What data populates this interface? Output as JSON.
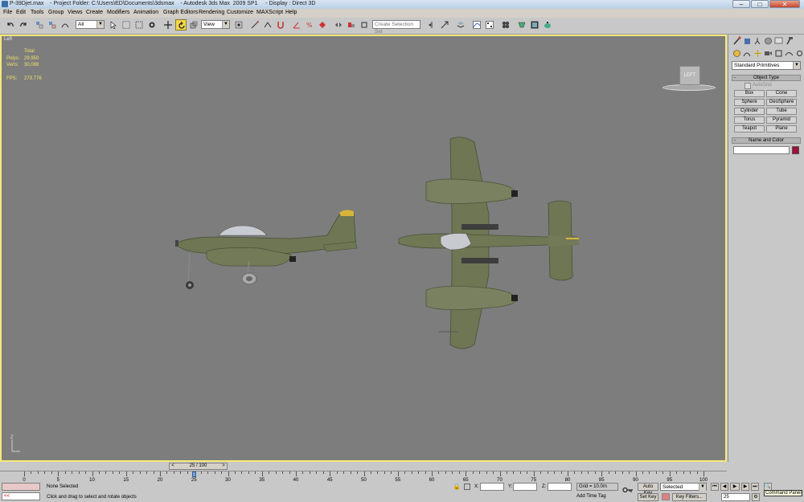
{
  "window": {
    "title": "P-39Djet.max    - Project Folder: C:\\Users\\ED\\Documents\\3dsmax    - Autodesk 3ds Max  2009 SP1     - Display : Direct 3D",
    "minimize": "–",
    "maximize": "□",
    "close": "✕"
  },
  "menu": [
    "File",
    "Edit",
    "Tools",
    "Group",
    "Views",
    "Create",
    "Modifiers",
    "Animation",
    "Graph Editors",
    "Rendering",
    "Customize",
    "MAXScript",
    "Help"
  ],
  "toolbar": {
    "selection_filter": "All",
    "reference_coord": "View",
    "named_selection_placeholder": "Create Selection Set"
  },
  "viewport": {
    "label": "Left",
    "stats_header": "Total",
    "polys_label": "Polys:",
    "polys_value": "29,950",
    "verts_label": "Verts:",
    "verts_value": "30,088",
    "fps_label": "FPS:",
    "fps_value": "273.776",
    "viewcube_label": "LEFT",
    "axis_label": "Z"
  },
  "command_panel": {
    "category_dropdown": "Standard Primitives",
    "object_type_title": "Object Type",
    "autogrid_label": "AutoGrid",
    "buttons": [
      "Box",
      "Cone",
      "Sphere",
      "GeoSphere",
      "Cylinder",
      "Tube",
      "Torus",
      "Pyramid",
      "Teapot",
      "Plane"
    ],
    "name_color_title": "Name and Color",
    "object_color": "#a0103a",
    "tooltip": "Command Panel"
  },
  "timeline": {
    "frame_display": "25 / 100",
    "current_frame": 25,
    "ticks": [
      0,
      5,
      10,
      15,
      20,
      25,
      30,
      35,
      40,
      45,
      50,
      55,
      60,
      65,
      70,
      75,
      80,
      85,
      90,
      95,
      100
    ]
  },
  "status": {
    "selection_info": "None Selected",
    "prompt": "Click and drag to select and rotate objects",
    "x_label": "X:",
    "y_label": "Y:",
    "z_label": "Z:",
    "grid": "Grid = 10.0m",
    "add_time_tag": "Add Time Tag",
    "auto_key": "Auto Key",
    "set_key": "Set Key",
    "key_mode_dropdown": "Selected",
    "key_filters": "Key Filters...",
    "frame_field": "25",
    "maxscript_arrow": "<<"
  },
  "colors": {
    "viewport_bg": "#7d7d7d",
    "active_border": "#f5e87a",
    "stats_text": "#f0e26a",
    "airframe": "#6e7654"
  }
}
